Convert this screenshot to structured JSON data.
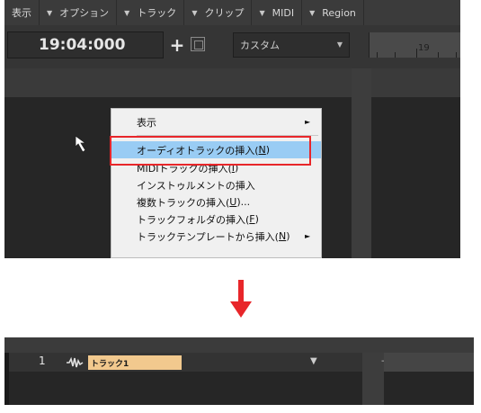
{
  "menubar": {
    "items": [
      {
        "label": "表示",
        "has_arrow": false
      },
      {
        "label": "オプション",
        "has_arrow": true
      },
      {
        "label": "トラック",
        "has_arrow": true
      },
      {
        "label": "クリップ",
        "has_arrow": true
      },
      {
        "label": "MIDI",
        "has_arrow": true
      },
      {
        "label": "Region",
        "has_arrow": true
      }
    ]
  },
  "toolbar": {
    "time": "19:04:000",
    "add_icon": "+",
    "preset_select": "カスタム",
    "ruler_number": "19"
  },
  "context_menu": {
    "items": [
      {
        "text": "表示",
        "accel": "",
        "tail": "",
        "submenu": true
      },
      {
        "text": "オーディオトラックの挿入(",
        "accel": "N",
        "tail": ")",
        "submenu": false,
        "highlighted": true
      },
      {
        "text": "MIDIトラックの挿入(",
        "accel": "I",
        "tail": ")",
        "submenu": false
      },
      {
        "text": "インストゥルメントの挿入",
        "accel": "",
        "tail": "",
        "submenu": false
      },
      {
        "text": "複数トラックの挿入(",
        "accel": "U",
        "tail": ")...",
        "submenu": false
      },
      {
        "text": "トラックフォルダの挿入(",
        "accel": "F",
        "tail": ")",
        "submenu": false
      },
      {
        "text": "トラックテンプレートから挿入(",
        "accel": "N",
        "tail": ")",
        "submenu": true
      }
    ]
  },
  "annotation": {
    "highlight_color": "#e8262a",
    "arrow_color": "#e8262a"
  },
  "result_track": {
    "number": "1",
    "name": "トラック1",
    "icon": "audio-wave-icon",
    "name_bg": "#f2c98e",
    "right_marker": "-"
  }
}
